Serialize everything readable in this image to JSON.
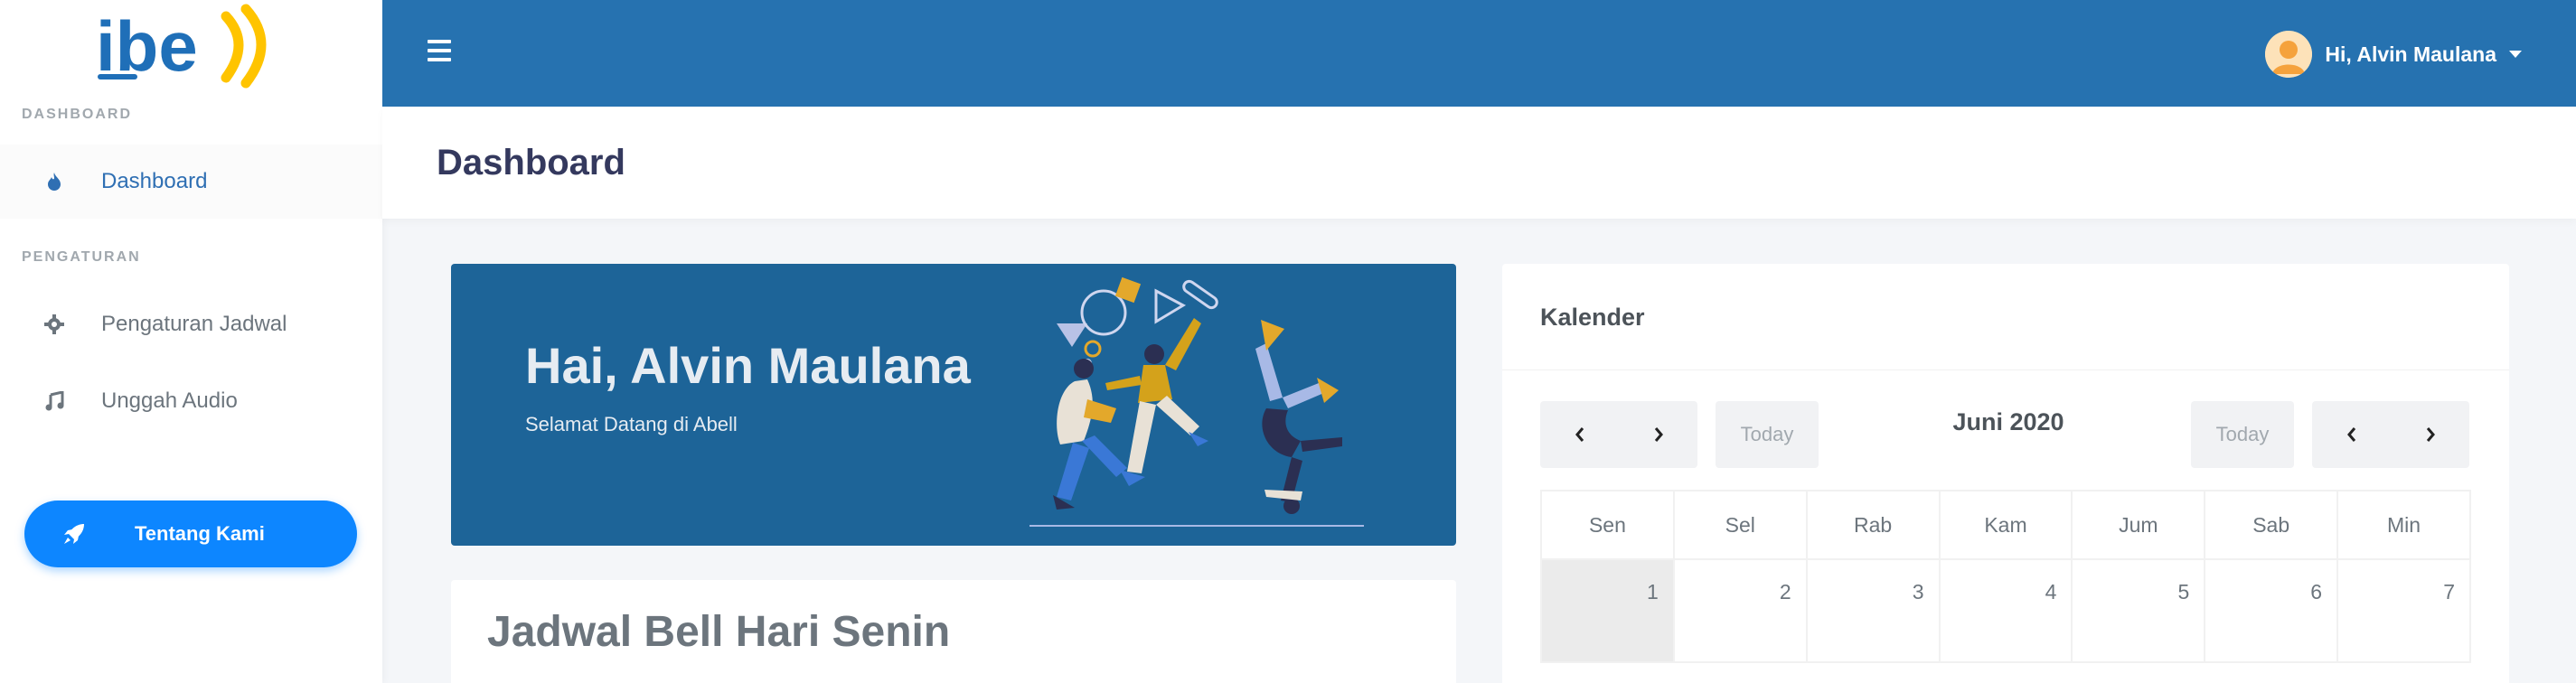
{
  "app": {
    "logo_text": "Abell"
  },
  "sidebar": {
    "headers": [
      "DASHBOARD",
      "PENGATURAN"
    ],
    "items": [
      {
        "label": "Dashboard",
        "icon": "fire-icon",
        "active": true
      },
      {
        "label": "Pengaturan Jadwal",
        "icon": "gear-icon",
        "active": false
      },
      {
        "label": "Unggah Audio",
        "icon": "music-icon",
        "active": false
      }
    ],
    "about_button": {
      "label": "Tentang Kami",
      "icon": "rocket-icon"
    }
  },
  "topbar": {
    "user_greeting": "Hi, Alvin Maulana"
  },
  "section": {
    "title": "Dashboard"
  },
  "hero": {
    "title": "Hai, Alvin Maulana",
    "subtitle": "Selamat Datang di Abell"
  },
  "bell_card": {
    "title": "Jadwal Bell Hari Senin"
  },
  "calendar": {
    "title": "Kalender",
    "month_label": "Juni 2020",
    "today_label": "Today",
    "weekdays": [
      "Sen",
      "Sel",
      "Rab",
      "Kam",
      "Jum",
      "Sab",
      "Min"
    ],
    "week1": [
      "1",
      "2",
      "3",
      "4",
      "5",
      "6",
      "7"
    ]
  },
  "colors": {
    "topbar": "#2672b0",
    "hero": "#1d6498",
    "accent_button": "#0d86ff",
    "logo_blue": "#1f6fb8",
    "logo_yellow": "#ffc400"
  }
}
